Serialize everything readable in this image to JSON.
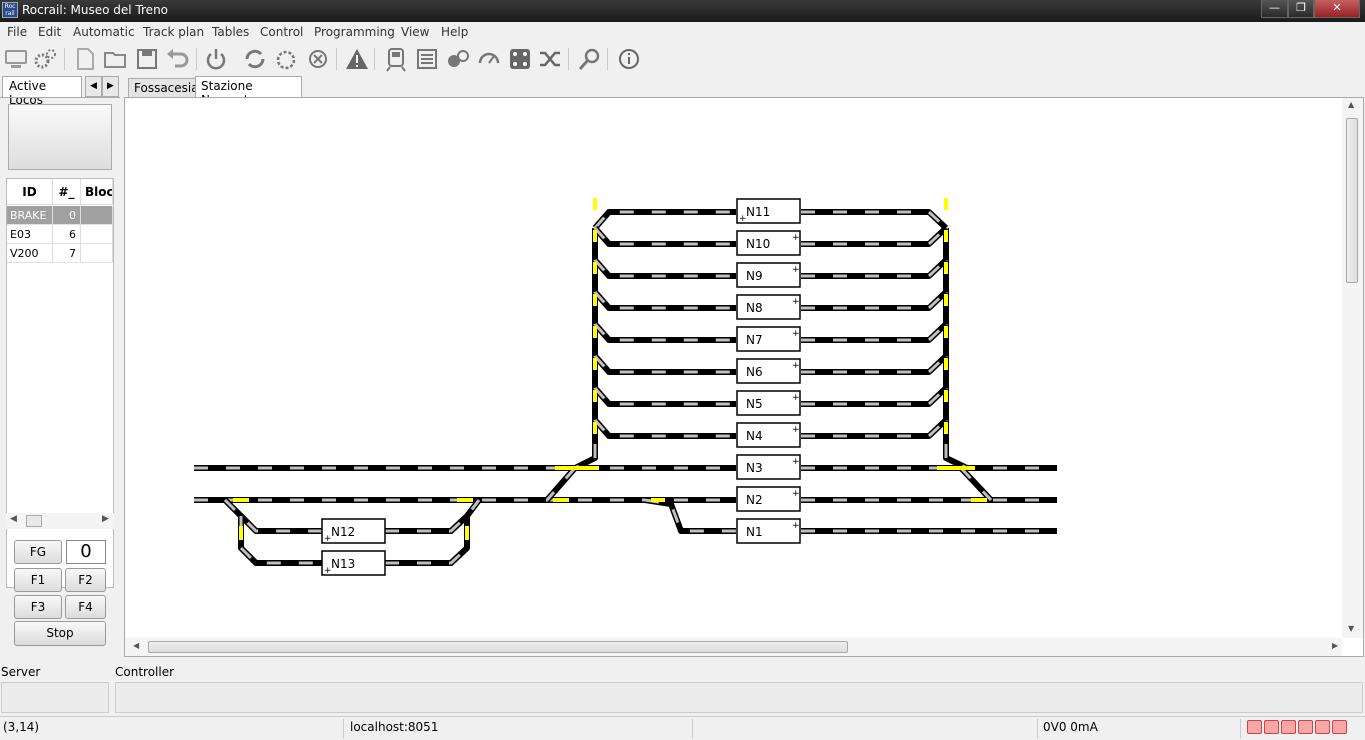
{
  "window": {
    "title": "Rocrail: Museo del Treno",
    "app_icon": "Roc rail"
  },
  "menu": [
    "File",
    "Edit",
    "Automatic",
    "Track plan",
    "Tables",
    "Control",
    "Programming",
    "View",
    "Help"
  ],
  "left_tabs": {
    "active": "Active Locos"
  },
  "loco_table": {
    "headers": [
      "ID",
      "#_",
      "Block"
    ],
    "rows": [
      {
        "id": "BRAKE",
        "addr": "0",
        "block": ""
      },
      {
        "id": "E03",
        "addr": "6",
        "block": ""
      },
      {
        "id": "V200",
        "addr": "7",
        "block": ""
      }
    ]
  },
  "loco_controls": {
    "fg": "FG",
    "speed": "0",
    "f1": "F1",
    "f2": "F2",
    "f3": "F3",
    "f4": "F4",
    "stop": "Stop"
  },
  "plan_tabs": [
    "Fossacesia",
    "Stazione Nascosta"
  ],
  "active_plan_tab": "Stazione Nascosta",
  "blocks": [
    "N11",
    "N10",
    "N9",
    "N8",
    "N7",
    "N6",
    "N5",
    "N4",
    "N3",
    "N2",
    "N1",
    "N12",
    "N13"
  ],
  "bottom": {
    "server_label": "Server",
    "controller_label": "Controller"
  },
  "status": {
    "coords": "(3,14)",
    "host": "localhost:8051",
    "power": "0V0 0mA"
  },
  "colors": {
    "track": "#000000",
    "track_light": "#bfbfbf",
    "occupied": "#ffff00",
    "led": "#f9a6a6"
  }
}
